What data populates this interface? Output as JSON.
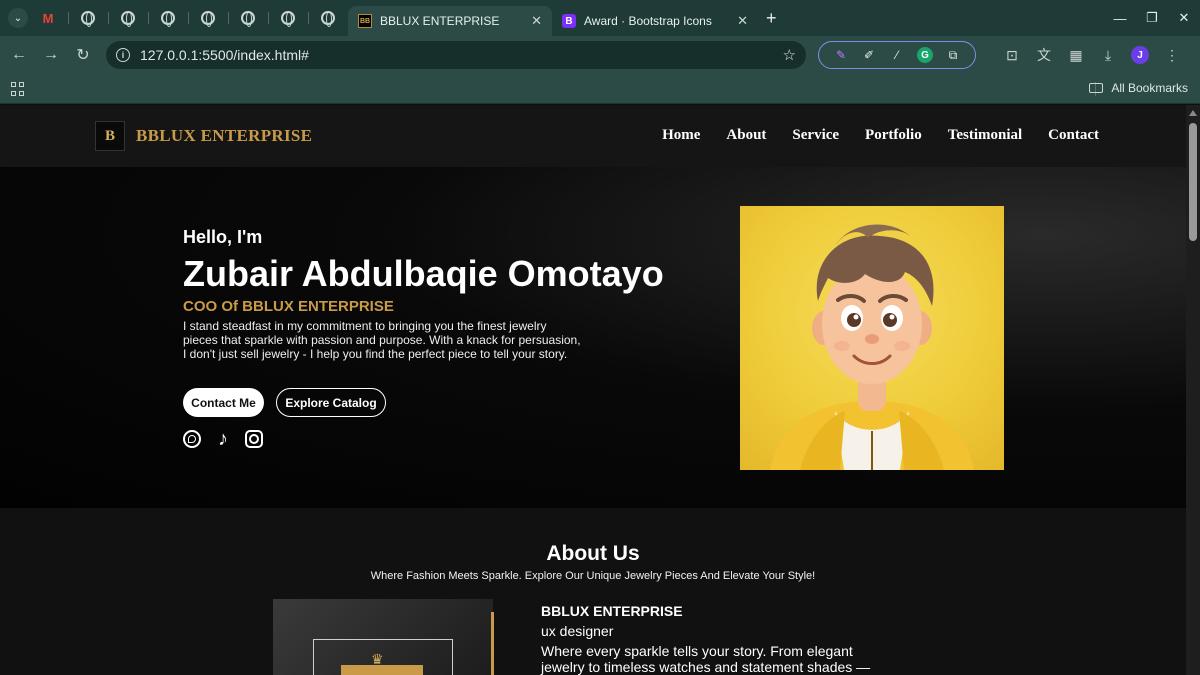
{
  "browser": {
    "tabs": [
      {
        "title": "BBLUX ENTERPRISE",
        "favicon": "bblux-favicon",
        "active": true
      },
      {
        "title": "Award · Bootstrap Icons",
        "favicon": "bootstrap-favicon",
        "active": false
      }
    ],
    "favicon_bb_text": "BB",
    "favicon_b_text": "B",
    "url": "127.0.0.1:5500/index.html#",
    "profile_initial": "J",
    "bookmarks_label": "All Bookmarks",
    "extension_g": "G"
  },
  "site": {
    "logo_text": "B",
    "brand": "BBLUX ENTERPRISE",
    "menu": [
      "Home",
      "About",
      "Service",
      "Portfolio",
      "Testimonial",
      "Contact"
    ],
    "hero": {
      "greeting": "Hello, I'm",
      "name": "Zubair Abdulbaqie Omotayo",
      "role": "COO Of BBLUX ENTERPRISE",
      "bio": "I stand steadfast in my commitment to bringing you the finest jewelry pieces that sparkle with passion and purpose. With a knack for persuasion, I don't just sell jewelry - I help you find the perfect piece to tell your story.",
      "contact_button": "Contact Me",
      "catalog_button": "Explore Catalog"
    },
    "about": {
      "title": "About Us",
      "subtitle": "Where Fashion Meets Sparkle. Explore Our Unique Jewelry Pieces And Elevate Your Style!",
      "company": "BBLUX ENTERPRISE",
      "position": "ux designer",
      "text": "Where every sparkle tells your story. From elegant jewelry to timeless watches and statement shades —"
    }
  },
  "colors": {
    "accent_gold": "#c99a47",
    "chrome_bg": "#1f3b37",
    "toolbar_bg": "#2c4a46",
    "avatar_bg": "#efcc3a"
  }
}
